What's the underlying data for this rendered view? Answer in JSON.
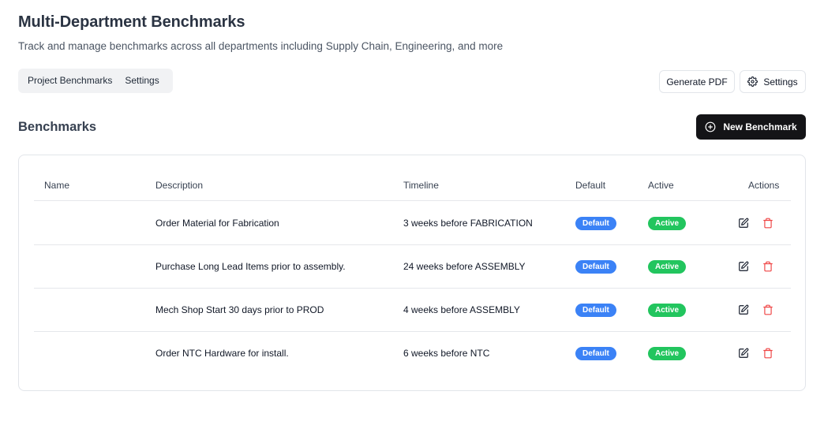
{
  "header": {
    "title": "Multi-Department Benchmarks",
    "subtitle": "Track and manage benchmarks across all departments including Supply Chain, Engineering, and more"
  },
  "tabs": [
    {
      "label": "Project Benchmarks"
    },
    {
      "label": "Settings"
    }
  ],
  "toolbar": {
    "generate_pdf_label": "Generate PDF",
    "settings_label": "Settings",
    "settings_icon": "gear-icon"
  },
  "section": {
    "title": "Benchmarks",
    "new_button_label": "New Benchmark",
    "new_button_icon": "plus-circle-icon"
  },
  "table": {
    "columns": {
      "name": "Name",
      "description": "Description",
      "timeline": "Timeline",
      "default": "Default",
      "active": "Active",
      "actions": "Actions"
    },
    "rows": [
      {
        "name": "",
        "description": "Order Material for Fabrication",
        "timeline": "3 weeks before FABRICATION",
        "default": "Default",
        "active": "Active"
      },
      {
        "name": "",
        "description": "Purchase Long Lead Items prior to assembly.",
        "timeline": "24 weeks before ASSEMBLY",
        "default": "Default",
        "active": "Active"
      },
      {
        "name": "",
        "description": "Mech Shop Start 30 days prior to PROD",
        "timeline": "4 weeks before ASSEMBLY",
        "default": "Default",
        "active": "Active"
      },
      {
        "name": "",
        "description": "Order NTC Hardware for install.",
        "timeline": "6 weeks before NTC",
        "default": "Default",
        "active": "Active"
      }
    ]
  },
  "colors": {
    "default_badge": "#3b82f6",
    "active_badge": "#22c55e",
    "delete_icon": "#ef4444",
    "primary_button": "#141417"
  }
}
